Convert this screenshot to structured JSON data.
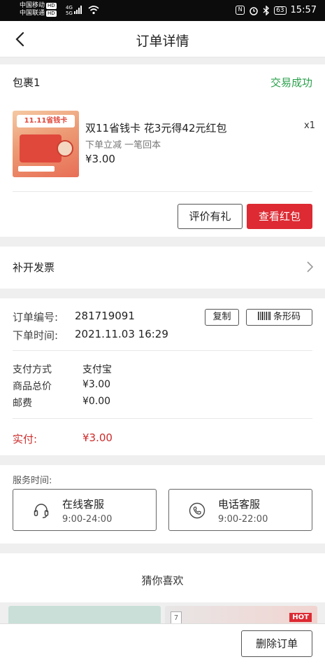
{
  "status_bar": {
    "carrier_1": "中国移动",
    "carrier_2": "中国联通",
    "hd_badge": "HD",
    "net_label": "4G",
    "net_label_2": "5G",
    "battery": "63",
    "time": "15:57"
  },
  "header": {
    "title": "订单详情"
  },
  "package": {
    "title": "包裹1",
    "status": "交易成功",
    "status_color": "#2aa04b",
    "product": {
      "image_text": "11.11省钱卡",
      "name": "双11省钱卡 花3元得42元红包",
      "subtitle": "下单立减 一笔回本",
      "price": "¥3.00",
      "quantity": "x1"
    },
    "review_button": "评价有礼",
    "view_redpacket_button": "查看红包"
  },
  "invoice": {
    "label": "补开发票"
  },
  "order": {
    "number_label": "订单编号:",
    "number_value": "281719091",
    "copy_button": "复制",
    "barcode_button": "条形码",
    "time_label": "下单时间:",
    "time_value": "2021.11.03 16:29",
    "pay_method_label": "支付方式",
    "pay_method_value": "支付宝",
    "goods_total_label": "商品总价",
    "goods_total_value": "¥3.00",
    "shipping_label": "邮费",
    "shipping_value": "¥0.00",
    "paid_label": "实付:",
    "paid_value": "¥3.00",
    "paid_color": "#cc2b2b"
  },
  "service": {
    "label": "服务时间:",
    "online": {
      "name": "在线客服",
      "hours": "9:00-24:00",
      "icon": "headset-icon"
    },
    "phone": {
      "name": "电话客服",
      "hours": "9:00-22:00",
      "icon": "phone-icon"
    }
  },
  "recommend": {
    "title": "猜你喜欢",
    "tile_2_number": "7",
    "hot_badge": "HOT"
  },
  "bottom_bar": {
    "delete_button": "删除订单"
  },
  "accent_red": "#dd2a33"
}
